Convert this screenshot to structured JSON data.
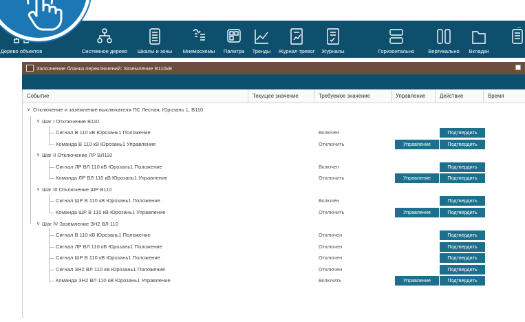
{
  "toolbar": {
    "buttons": [
      {
        "label": "Дерево объектов",
        "icon": "object-tree-icon"
      },
      {
        "label": "Системное дерево",
        "icon": "system-tree-icon"
      },
      {
        "label": "Шкалы и зоны",
        "icon": "scales-zones-icon"
      },
      {
        "label": "Мнемосхемы",
        "icon": "mnemonic-diagram-icon"
      },
      {
        "label": "Палитра",
        "icon": "palette-icon"
      },
      {
        "label": "Тренды",
        "icon": "trends-icon"
      },
      {
        "label": "Журнал тревог",
        "icon": "alarm-log-icon"
      },
      {
        "label": "Журналы",
        "icon": "logs-icon"
      },
      {
        "label": "Горизонтально",
        "icon": "layout-horizontal-icon"
      },
      {
        "label": "Вертикально",
        "icon": "layout-vertical-icon"
      },
      {
        "label": "Вкладки",
        "icon": "tabs-icon"
      }
    ]
  },
  "dialog": {
    "title": "Заполнение бланка переключений: Заземление В110кВ"
  },
  "table": {
    "columns": [
      "Событие",
      "Текущее значение",
      "Требуемое значение",
      "Управление",
      "Действие",
      "Время"
    ],
    "rows": [
      {
        "level": 0,
        "text": "Отключение и заземление выключателя ПС Лесная, Юрозань 1, В110",
        "required": "",
        "control": "",
        "action": ""
      },
      {
        "level": 1,
        "text": "Шаг I Отключение В110",
        "required": "",
        "control": "",
        "action": ""
      },
      {
        "level": 2,
        "text": "Сигнал В 110 кВ Юрозань1 Положение",
        "required": "Включен",
        "control": "",
        "action": "Подтвердить"
      },
      {
        "level": 2,
        "text": "Команда В 110 кВ Юрозань1 Управление",
        "required": "Отключить",
        "control": "Управление",
        "action": "Подтвердить"
      },
      {
        "level": 1,
        "text": "Шаг II Отключение ЛР ВЛ110",
        "required": "",
        "control": "",
        "action": ""
      },
      {
        "level": 2,
        "text": "Сигнал ЛР ВЛ 110 кВ Юрозань1 Положение",
        "required": "Включен",
        "control": "",
        "action": "Подтвердить"
      },
      {
        "level": 2,
        "text": "Команда ЛР ВЛ 110 кВ Юрозань1 Управление",
        "required": "Отключить",
        "control": "Управление",
        "action": "Подтвердить"
      },
      {
        "level": 1,
        "text": "Шаг III Отключение ШР В110",
        "required": "",
        "control": "",
        "action": ""
      },
      {
        "level": 2,
        "text": "Сигнал ШР В 110 кВ Юрозань1 Положение",
        "required": "Включен",
        "control": "",
        "action": "Подтвердить"
      },
      {
        "level": 2,
        "text": "Команда ШР В 110 кВ Юрозань1 Управление",
        "required": "Отключить",
        "control": "Управление",
        "action": "Подтвердить"
      },
      {
        "level": 1,
        "text": "Шаг IV Заземление ЗН2 ВЛ 110",
        "required": "",
        "control": "",
        "action": ""
      },
      {
        "level": 2,
        "text": "Сигнал В 110 кВ Юрозань1 Положение",
        "required": "Отключен",
        "control": "",
        "action": "Подтвердить"
      },
      {
        "level": 2,
        "text": "Сигнал ЛР ВЛ 110 кВ Юрозань1 Положение",
        "required": "Отключен",
        "control": "",
        "action": "Подтвердить"
      },
      {
        "level": 2,
        "text": "Сигнал ШР В 110 кВ Юрозань1 Положение",
        "required": "Отключен",
        "control": "",
        "action": "Подтвердить"
      },
      {
        "level": 2,
        "text": "Сигнал ЗН2 ВЛ 110 кВ Юрозань1 Положение",
        "required": "Отключен",
        "control": "",
        "action": "Подтвердить"
      },
      {
        "level": 2,
        "text": "Команда ЗН2 ВЛ 110 кВ Юрозань1 Управление",
        "required": "Включить",
        "control": "Управление",
        "action": "Подтвердить"
      }
    ]
  }
}
